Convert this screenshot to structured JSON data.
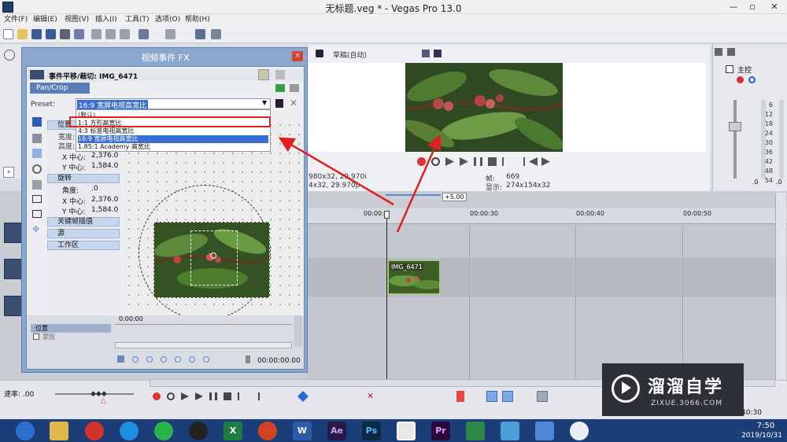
{
  "window": {
    "title": "无标题.veg * - Vegas Pro 13.0",
    "min": "—",
    "max": "▫",
    "close": "✕"
  },
  "menu": [
    "文件(F)",
    "编辑(E)",
    "视图(V)",
    "插入(I)",
    "工具(T)",
    "选项(O)",
    "帮助(H)"
  ],
  "preview": {
    "quality": "草稿(自动)",
    "left_info": [
      "980x32, 29.970i",
      "4x32, 29.970p"
    ],
    "frame_label": "帧:",
    "frame_value": "669",
    "display_label": "显示:",
    "display_value": "274x154x32"
  },
  "mixer": {
    "title": "主控",
    "scale": [
      "6",
      "12",
      "18",
      "24",
      "30",
      "36",
      "42",
      "48",
      "54"
    ],
    "left_val": ".0",
    "right_val": ".0"
  },
  "timeline": {
    "ticks": [
      "00:00:2",
      "00:00:30",
      "00:00:40",
      "00:00:50"
    ],
    "rate_marker": "+5.00",
    "clip_name": "IMG_6471"
  },
  "dialog": {
    "title": "视频事件 FX",
    "close": "×",
    "event_title": "事件平移/裁切: IMG_6471",
    "tab": "Pan/Crop",
    "preset_label": "Preset:",
    "preset_value": "16:9 宽屏电视高宽比",
    "options": [
      "(默认)",
      "1:1 方形高宽比",
      "4:3 标准电视高宽比",
      "16:9 宽屏电视高宽比",
      "1.85:1 Academy 高宽比"
    ],
    "sec_position": "位置",
    "pos_rows": [
      [
        "宽度:",
        ""
      ],
      [
        "高度:",
        ""
      ],
      [
        "X 中心:",
        "2,376.0"
      ],
      [
        "Y 中心:",
        "1,584.0"
      ]
    ],
    "sec_rotation": "旋转",
    "rot_rows": [
      [
        "角度:",
        ".0"
      ],
      [
        "X 中心:",
        "2,376.0"
      ],
      [
        "Y 中心:",
        "1,584.0"
      ]
    ],
    "sec_keyframe": "关键帧插值",
    "sec_source": "源",
    "sec_workspace": "工作区",
    "kf_track1": "位置",
    "kf_track2": "蒙版",
    "kf_start": "0:00:00",
    "kf_time": "00:00:00.00"
  },
  "status": {
    "rate": "速率: .00",
    "time": "40:30"
  },
  "taskbar": {
    "apps": [
      "Ae",
      "Ps",
      "Pr",
      "W",
      "X"
    ],
    "time": "7:50",
    "date": "2019/10/31"
  },
  "watermark": {
    "title": "溜溜自学",
    "url": "ZIXUE.3066.COM"
  },
  "colors": {
    "accent": "#3b6fcf",
    "dialog_frame": "#8aa8cf",
    "highlight_box": "#e02020",
    "taskbar": "#1b3d78"
  }
}
